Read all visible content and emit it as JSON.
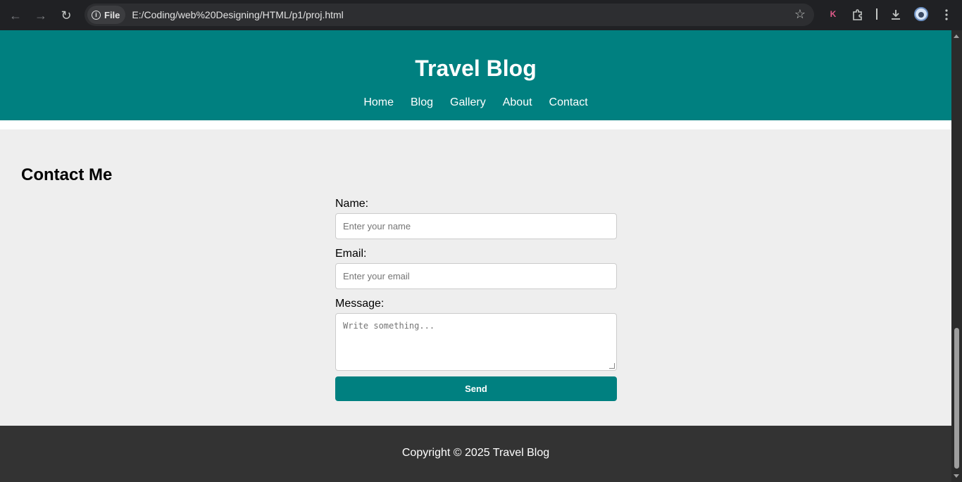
{
  "browser": {
    "site_chip_label": "File",
    "url": "E:/Coding/web%20Designing/HTML/p1/proj.html",
    "extension_letter": "K"
  },
  "header": {
    "title": "Travel Blog",
    "nav": [
      "Home",
      "Blog",
      "Gallery",
      "About",
      "Contact"
    ]
  },
  "contact": {
    "heading": "Contact Me",
    "name_label": "Name:",
    "name_placeholder": "Enter your name",
    "email_label": "Email:",
    "email_placeholder": "Enter your email",
    "message_label": "Message:",
    "message_placeholder": "Write something...",
    "send_label": "Send"
  },
  "footer": {
    "copyright": "Copyright © 2025 Travel Blog"
  },
  "colors": {
    "primary": "#008080",
    "page_background": "#eeeeee",
    "footer_background": "#333333"
  }
}
